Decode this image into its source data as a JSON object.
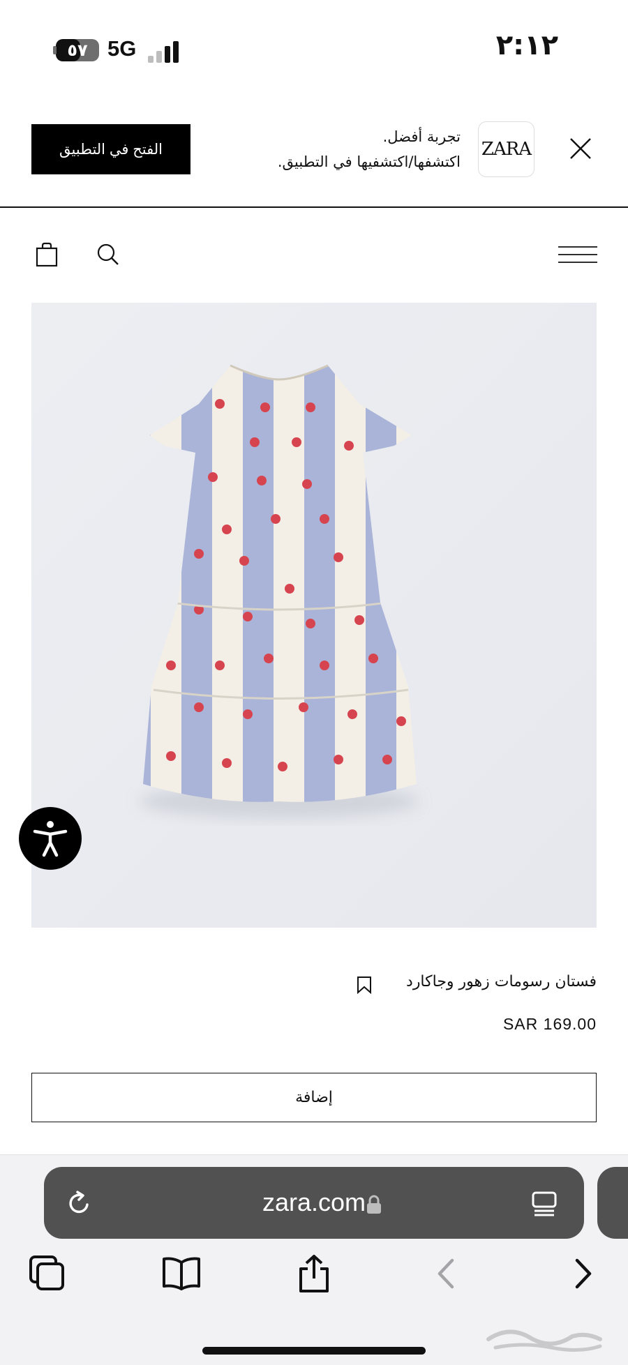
{
  "status_bar": {
    "time": "٢:١٢",
    "battery_level": "٥٧",
    "battery_fraction": 0.57,
    "network": "5G",
    "signal_bars_active": 2,
    "signal_bars_total": 4
  },
  "app_banner": {
    "open_app_label": "الفتح في التطبيق",
    "headline": "تجربة أفضل.",
    "subline": "اكتشفها/اكتشفيها في التطبيق.",
    "logo_text": "ZARA",
    "icons": {
      "close": "close-icon"
    }
  },
  "header": {
    "icons": {
      "bag": "shopping-bag-icon",
      "search": "search-icon",
      "menu": "hamburger-menu-icon"
    }
  },
  "product": {
    "name": "فستان رسومات زهور وجاكارد",
    "price": "SAR 169.00",
    "add_label": "إضافة",
    "image_icon": "product-photo-dress",
    "colors": {
      "stripe_blue": "#aab4d8",
      "stripe_cream": "#f4efe6",
      "flower_red": "#d6454f"
    }
  },
  "accessibility": {
    "icon": "accessibility-icon"
  },
  "browser": {
    "url": "zara.com",
    "icons": {
      "reload": "reload-icon",
      "lock": "lock-icon",
      "reader": "reader-mode-icon",
      "tabs": "tabs-icon",
      "bookmarks": "bookmarks-icon",
      "share": "share-icon",
      "back": "back-icon",
      "forward": "forward-icon"
    }
  },
  "colors": {
    "ink": "#111111",
    "url_bar": "#515151",
    "browser_bg": "#f2f2f4",
    "photo_bg": "#eceef2"
  }
}
